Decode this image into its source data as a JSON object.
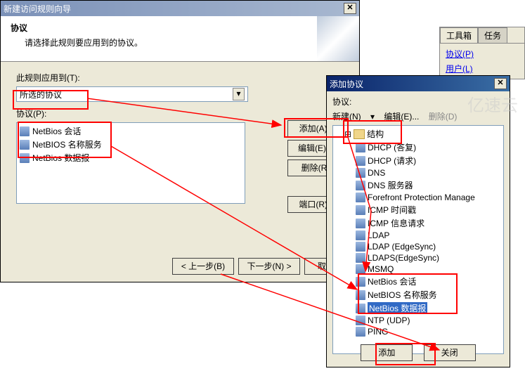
{
  "wizard": {
    "title": "新建访问规则向导",
    "header": "协议",
    "sub": "请选择此规则要应用到的协议。",
    "applyLabel": "此规则应用到(T):",
    "dropdownValue": "所选的协议",
    "protoLabel": "协议(P):",
    "items": [
      "NetBios 会话",
      "NetBIOS 名称服务",
      "NetBios 数据报"
    ],
    "btns": {
      "add": "添加(A)..",
      "edit": "编辑(E)...",
      "del": "删除(R)",
      "port": "端口(R).."
    },
    "nav": {
      "back": "< 上一步(B)",
      "next": "下一步(N) >",
      "cancel": "取消"
    }
  },
  "add": {
    "title": "添加协议",
    "label": "协议:",
    "toolbar": {
      "new": "新建(N)",
      "edit": "编辑(E)...",
      "del": "删除(D)"
    },
    "root": "结构",
    "tree": [
      "DHCP (答复)",
      "DHCP (请求)",
      "DNS",
      "DNS 服务器",
      "Forefront Protection Manage",
      "ICMP 时间戳",
      "ICMP 信息请求",
      "LDAP",
      "LDAP (EdgeSync)",
      "LDAPS(EdgeSync)",
      "MSMQ",
      "NetBios 会话",
      "NetBIOS 名称服务",
      "NetBios 数据报",
      "NTP (UDP)",
      "PING"
    ],
    "selectedIndex": 13,
    "btns": {
      "add": "添加",
      "close": "关闭"
    }
  },
  "panel": {
    "tabs": [
      "工具箱",
      "任务"
    ],
    "links": [
      "协议(P)",
      "用户(L)"
    ]
  },
  "watermark": "亿速云"
}
